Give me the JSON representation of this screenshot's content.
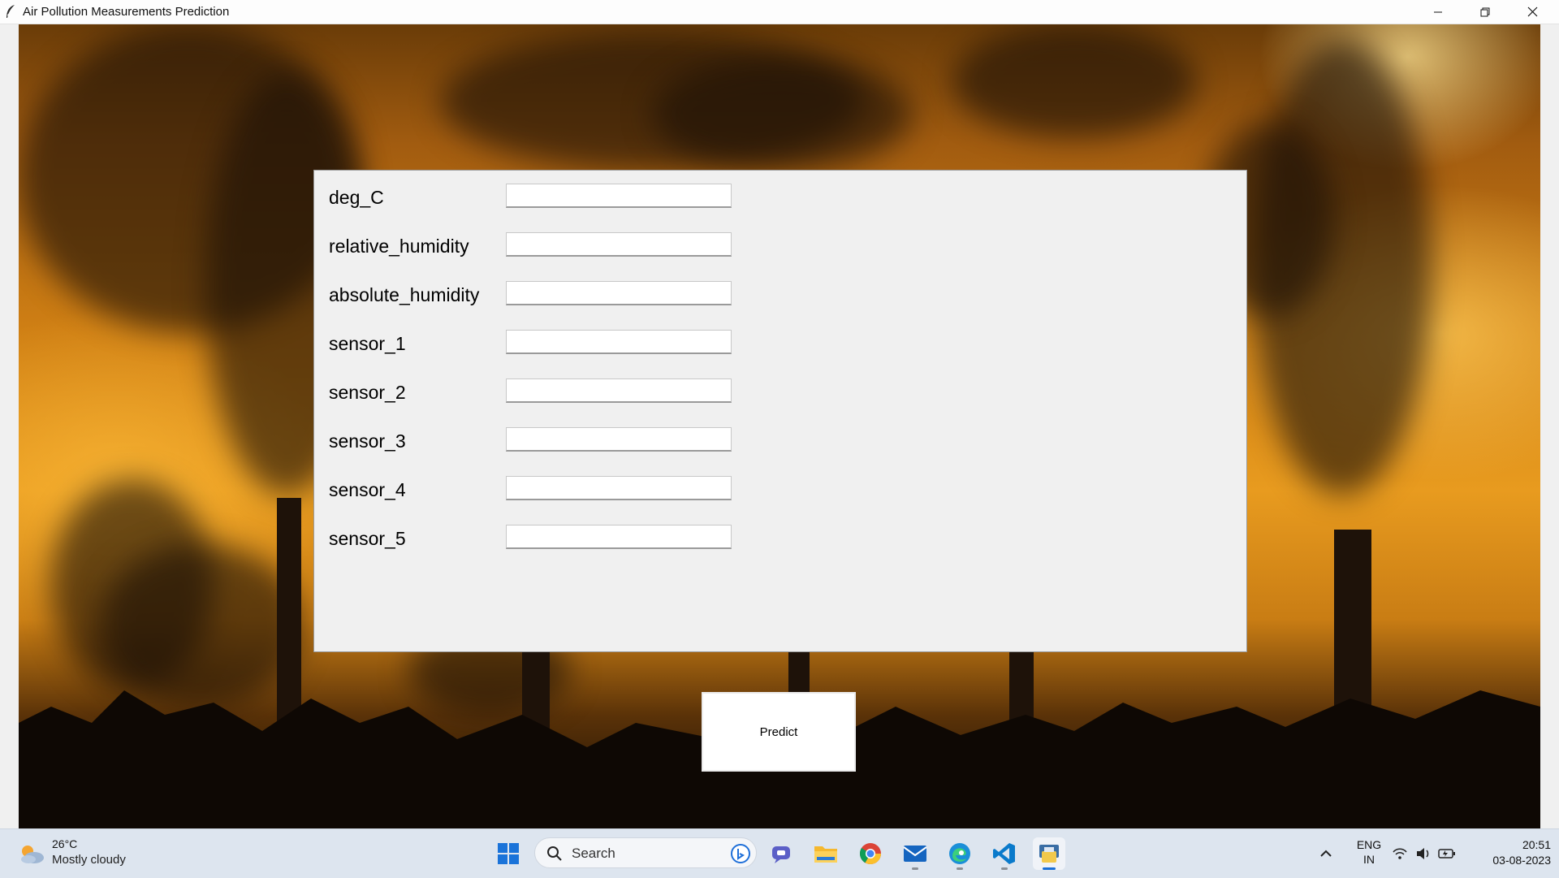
{
  "window": {
    "title": "Air Pollution Measurements Prediction"
  },
  "form": {
    "fields": [
      {
        "label": "deg_C",
        "value": ""
      },
      {
        "label": "relative_humidity",
        "value": ""
      },
      {
        "label": "absolute_humidity",
        "value": ""
      },
      {
        "label": "sensor_1",
        "value": ""
      },
      {
        "label": "sensor_2",
        "value": ""
      },
      {
        "label": "sensor_3",
        "value": ""
      },
      {
        "label": "sensor_4",
        "value": ""
      },
      {
        "label": "sensor_5",
        "value": ""
      }
    ],
    "predict_label": "Predict"
  },
  "taskbar": {
    "weather_temp": "26°C",
    "weather_desc": "Mostly cloudy",
    "search_placeholder": "Search",
    "lang_line1": "ENG",
    "lang_line2": "IN",
    "time": "20:51",
    "date": "03-08-2023",
    "pinned_apps": [
      "start-menu",
      "search",
      "bing-chat",
      "teams-chat",
      "file-explorer",
      "chrome",
      "mail",
      "edge",
      "vscode",
      "python"
    ]
  },
  "colors": {
    "accent": "#1a6fd6",
    "sky_orange": "#e89b1f"
  }
}
